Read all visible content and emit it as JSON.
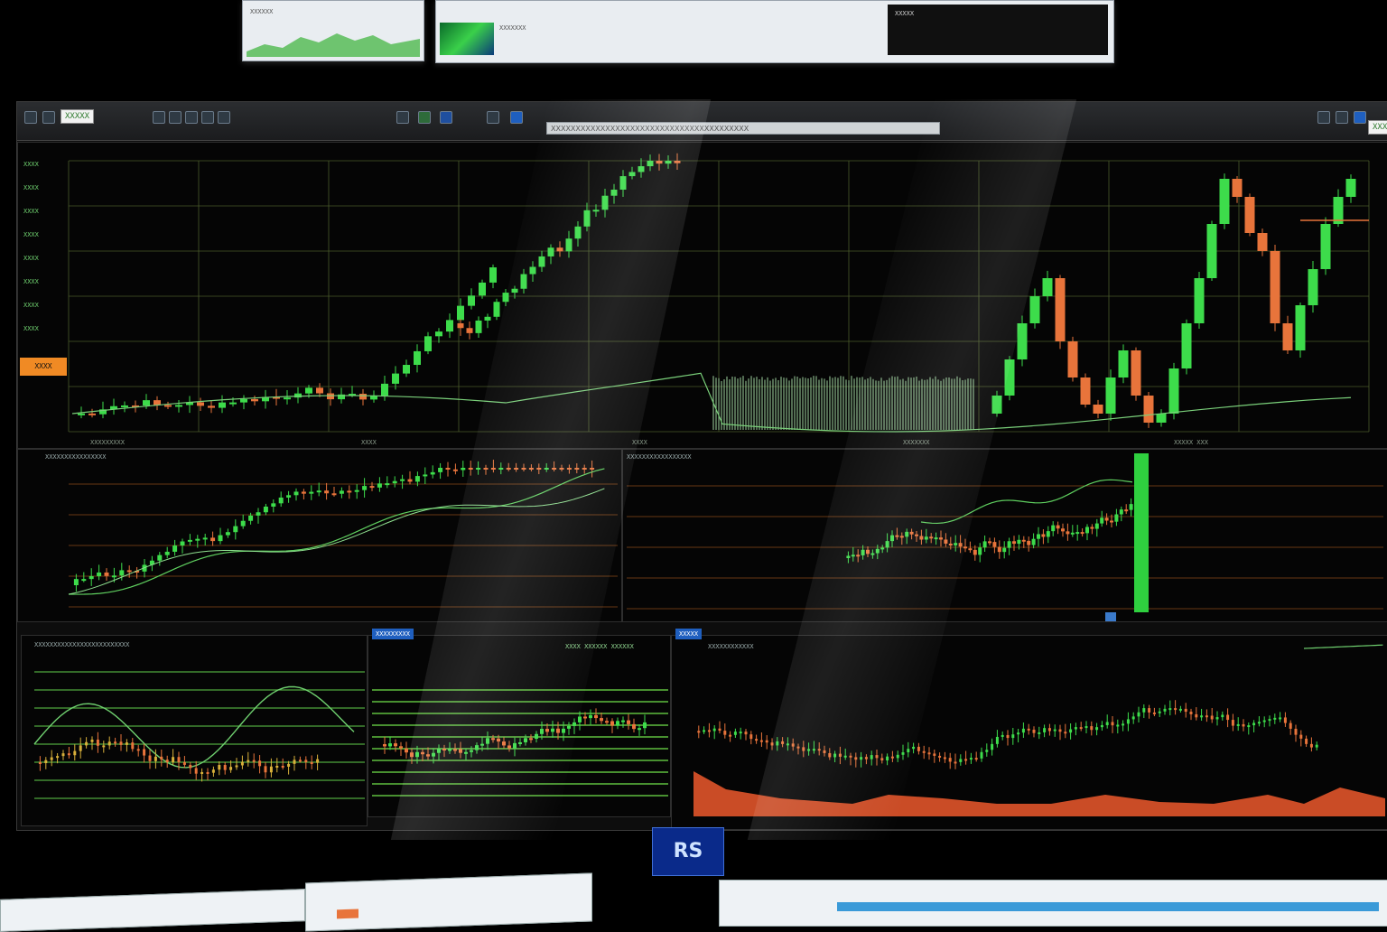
{
  "top_windows": [
    {
      "name": "top-window-1",
      "label": "XXXXXX"
    },
    {
      "name": "top-window-2",
      "label": "XXXXXXX"
    },
    {
      "name": "top-window-3",
      "label": "XXXXX"
    }
  ],
  "toolbar": {
    "symbols": [
      "XXXXX",
      "XXXX"
    ],
    "search_placeholder": "XXXXXXXXXXXXXXXXXXXXXXXXXXXXXXXXXXXXXXXX"
  },
  "main_chart": {
    "price_labels": [
      "XXXX",
      "XXXX",
      "XXXX",
      "XXXX",
      "XXXX",
      "XXXX",
      "XXXX",
      "XXXX"
    ],
    "highlight_label": "XXXX",
    "footer_labels": [
      "XXXXXXXXX",
      "XXXX",
      "XXXX",
      "XXXXXXX",
      "XXXXX XXX"
    ]
  },
  "middle_panels": [
    {
      "name": "middle-left",
      "header": "XXXXXXXXXXXXXXXX"
    },
    {
      "name": "middle-right",
      "header": "XXXXXXXXXXXXXXXXX"
    }
  ],
  "bottom_panels": [
    {
      "name": "bottom-left",
      "tab": "",
      "header": "XXXXXXXXXXXXXXXXXXXXXXXXX"
    },
    {
      "name": "bottom-center",
      "tab": "XXXXXXXXX",
      "header": "XXXX XXXXXX XXXXXX"
    },
    {
      "name": "bottom-right",
      "tab": "XXXXX",
      "header": "XXXXXXXXXXXX"
    }
  ],
  "logo_text": "RS",
  "colors": {
    "up": "#3ddc4b",
    "down": "#e8743b",
    "grid": "#4a5a2a",
    "accent_orange": "#f08a24"
  }
}
